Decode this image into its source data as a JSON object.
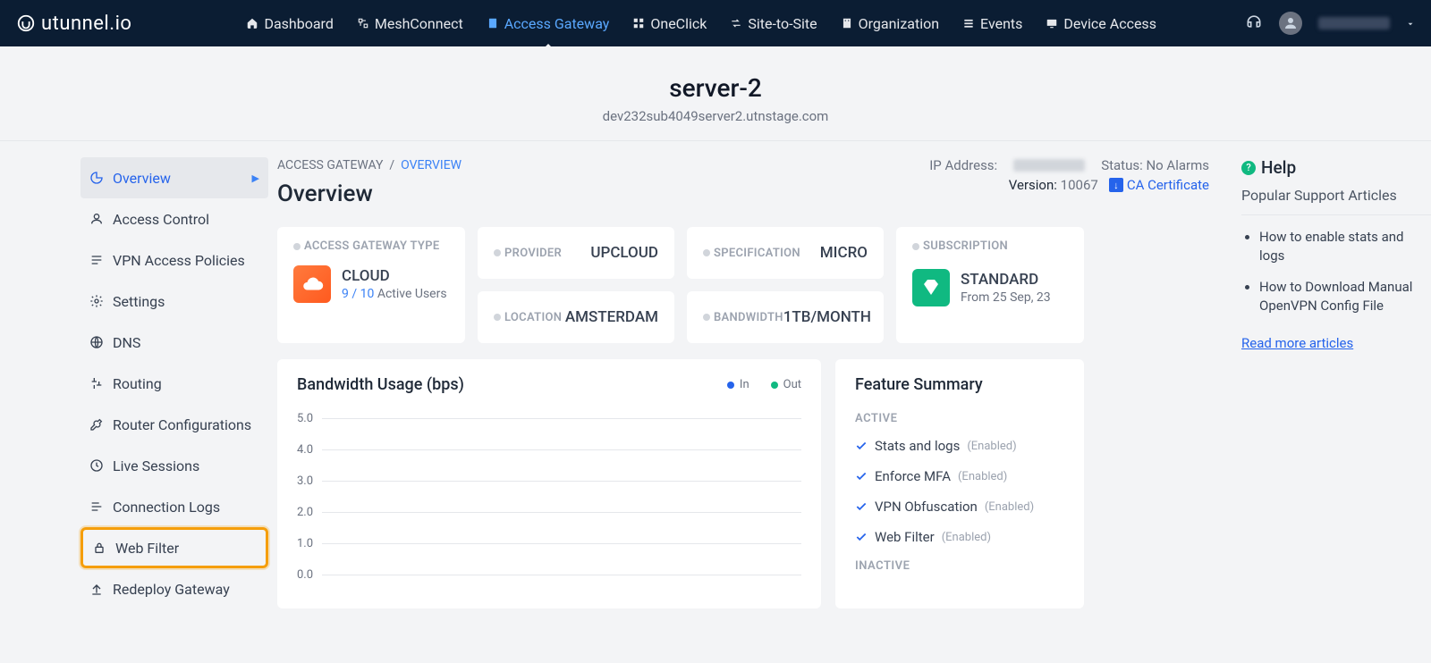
{
  "brand": "utunnel.io",
  "nav": {
    "dashboard": "Dashboard",
    "meshconnect": "MeshConnect",
    "access_gateway": "Access Gateway",
    "oneclick": "OneClick",
    "site_to_site": "Site-to-Site",
    "organization": "Organization",
    "events": "Events",
    "device_access": "Device Access"
  },
  "header": {
    "title": "server-2",
    "subtitle": "dev232sub4049server2.utnstage.com"
  },
  "sidebar": {
    "overview": "Overview",
    "access_control": "Access Control",
    "vpn_policies": "VPN Access Policies",
    "settings": "Settings",
    "dns": "DNS",
    "routing": "Routing",
    "router_cfg": "Router Configurations",
    "live_sessions": "Live Sessions",
    "connection_logs": "Connection Logs",
    "web_filter": "Web Filter",
    "redeploy": "Redeploy Gateway"
  },
  "breadcrumb": {
    "root": "ACCESS GATEWAY",
    "sep": "/",
    "current": "OVERVIEW"
  },
  "page_heading": "Overview",
  "status_line": {
    "ip_label": "IP Address:",
    "status_label": "Status:",
    "status_value": "No Alarms",
    "version_label": "Version:",
    "version_value": "10067",
    "ca_cert": "CA Certificate"
  },
  "cards": {
    "type_label": "ACCESS GATEWAY TYPE",
    "type_value": "CLOUD",
    "users_active": "9",
    "users_total": "10",
    "users_suffix": "Active Users",
    "provider_label": "PROVIDER",
    "provider_value": "UPCLOUD",
    "spec_label": "SPECIFICATION",
    "spec_value": "MICRO",
    "location_label": "LOCATION",
    "location_value": "AMSTERDAM",
    "bandwidth_label": "BANDWIDTH",
    "bandwidth_value": "1TB/MONTH",
    "subscription_label": "SUBSCRIPTION",
    "subscription_value": "STANDARD",
    "subscription_date": "From 25 Sep, 23"
  },
  "chart": {
    "title": "Bandwidth Usage (bps)",
    "legend_in": "In",
    "legend_out": "Out"
  },
  "chart_data": {
    "type": "line",
    "title": "Bandwidth Usage (bps)",
    "ylabel": "bps",
    "ylim": [
      0,
      5
    ],
    "y_ticks": [
      "5.0",
      "4.0",
      "3.0",
      "2.0",
      "1.0",
      "0.0"
    ],
    "series": [
      {
        "name": "In",
        "color": "#2563eb",
        "values": []
      },
      {
        "name": "Out",
        "color": "#10b981",
        "values": []
      }
    ]
  },
  "feature": {
    "title": "Feature Summary",
    "active_label": "ACTIVE",
    "inactive_label": "INACTIVE",
    "items": {
      "stats": "Stats and logs",
      "mfa": "Enforce MFA",
      "obf": "VPN Obfuscation",
      "webfilter": "Web Filter"
    },
    "enabled": "(Enabled)"
  },
  "help": {
    "title": "Help",
    "subtitle": "Popular Support Articles",
    "a1": "How to enable stats and logs",
    "a2": "How to Download Manual OpenVPN Config File",
    "more": "Read more articles"
  }
}
